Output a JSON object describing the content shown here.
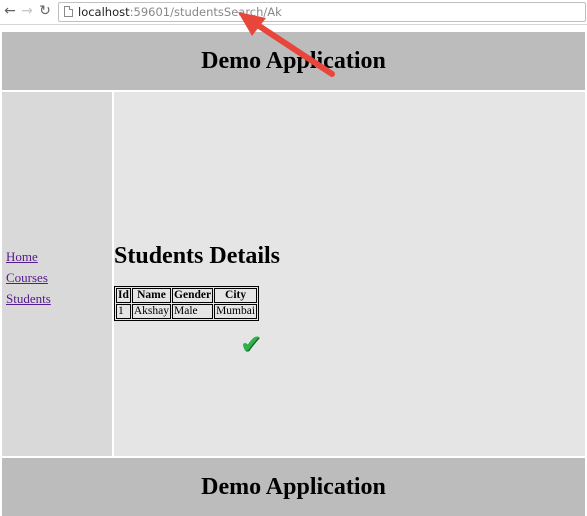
{
  "browser": {
    "url_host": "localhost",
    "url_path": ":59601/studentsSearch/Ak",
    "icons": {
      "back": "back-arrow-icon",
      "forward": "forward-arrow-icon",
      "reload": "reload-icon",
      "page": "page-icon"
    }
  },
  "header": {
    "title": "Demo Application"
  },
  "sidebar": {
    "items": [
      {
        "label": "Home"
      },
      {
        "label": "Courses"
      },
      {
        "label": "Students"
      }
    ]
  },
  "main": {
    "heading": "Students Details",
    "table": {
      "columns": [
        "Id",
        "Name",
        "Gender",
        "City"
      ],
      "rows": [
        [
          "1",
          "Akshay",
          "Male",
          "Mumbai"
        ]
      ]
    }
  },
  "footer": {
    "title": "Demo Application"
  },
  "annotations": {
    "arrow_color": "#e8463a",
    "check_color": "#2db34a",
    "check_glyph": "✔"
  },
  "colors": {
    "band": "#bcbcbc",
    "sidebar": "#d9d9d9",
    "main": "#e5e5e5",
    "link": "#551a8b"
  }
}
